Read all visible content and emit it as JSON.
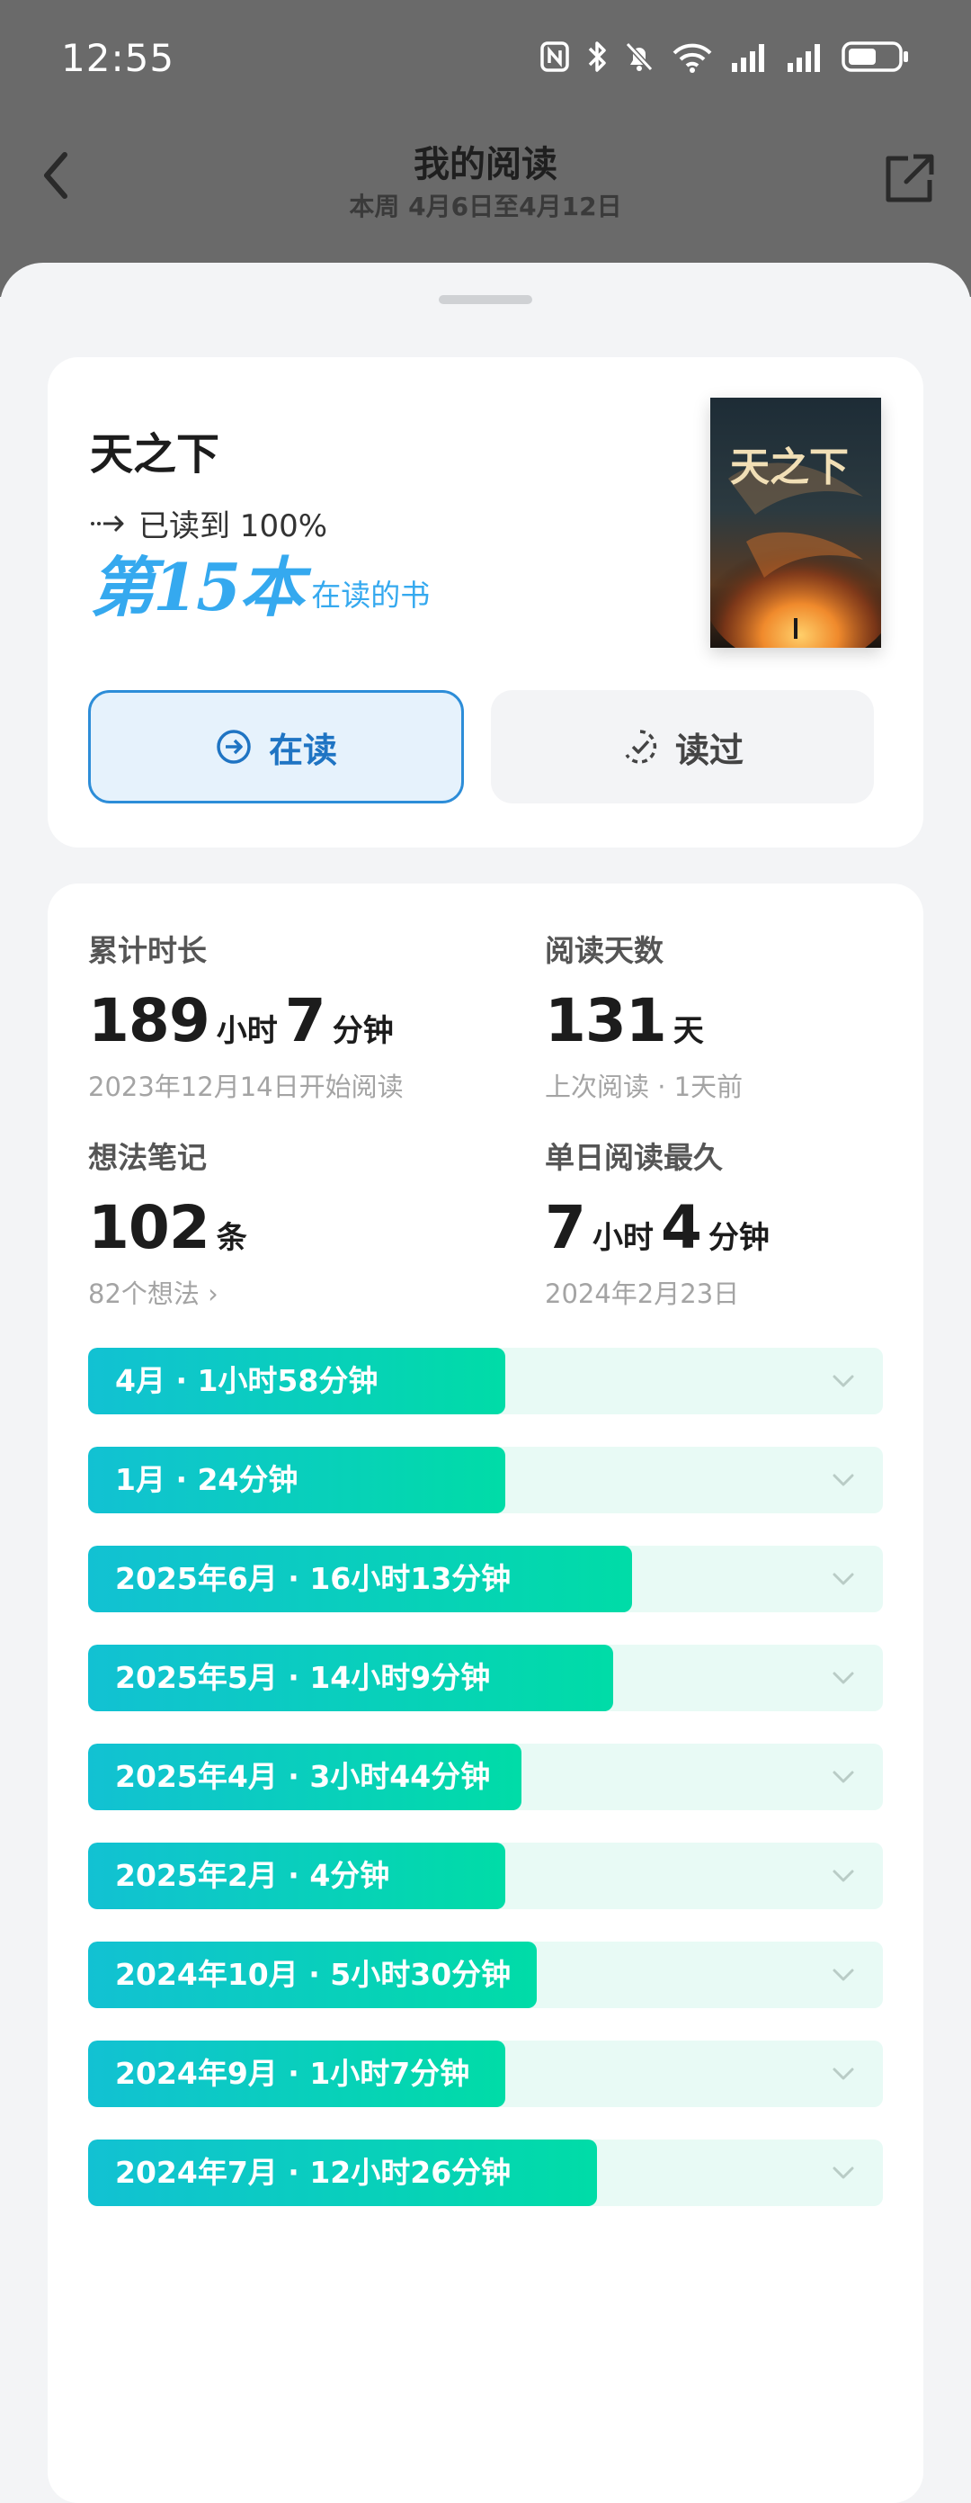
{
  "status_bar": {
    "time": "12:55"
  },
  "header": {
    "title": "我的阅读",
    "subtitle": "本周 4月6日至4月12日",
    "back_icon": "chevron-left-icon",
    "share_icon": "share-icon"
  },
  "book": {
    "title": "天之下",
    "progress_text": "已读到 100%",
    "rank_number_text": "第15本",
    "rank_suffix": "在读的书",
    "cover_text": "天之下",
    "buttons": {
      "reading_label": "在读",
      "read_label": "读过"
    }
  },
  "stats": {
    "total_time": {
      "label": "累计时长",
      "hours": "189",
      "hours_unit": "小时",
      "minutes": "7",
      "minutes_unit": "分钟",
      "sub": "2023年12月14日开始阅读"
    },
    "reading_days": {
      "label": "阅读天数",
      "value": "131",
      "unit": "天",
      "sub": "上次阅读 · 1天前"
    },
    "notes": {
      "label": "想法笔记",
      "value": "102",
      "unit": "条",
      "sub": "82个想法 ›"
    },
    "longest_day": {
      "label": "单日阅读最久",
      "hours": "7",
      "hours_unit": "小时",
      "minutes": "4",
      "minutes_unit": "分钟",
      "sub": "2024年2月23日"
    }
  },
  "monthly": [
    {
      "label": "4月 · 1小时58分钟",
      "fraction": 0.525
    },
    {
      "label": "1月 · 24分钟",
      "fraction": 0.525
    },
    {
      "label": "2025年6月 · 16小时13分钟",
      "fraction": 0.684
    },
    {
      "label": "2025年5月 · 14小时9分钟",
      "fraction": 0.661
    },
    {
      "label": "2025年4月 · 3小时44分钟",
      "fraction": 0.545
    },
    {
      "label": "2025年2月 · 4分钟",
      "fraction": 0.525
    },
    {
      "label": "2024年10月 · 5小时30分钟",
      "fraction": 0.564
    },
    {
      "label": "2024年9月 · 1小时7分钟",
      "fraction": 0.525
    },
    {
      "label": "2024年7月 · 12小时26分钟",
      "fraction": 0.64
    }
  ],
  "colors": {
    "accent_blue": "#2d8dd8",
    "teal_start": "#12c1d3",
    "teal_end": "#00dca7"
  }
}
